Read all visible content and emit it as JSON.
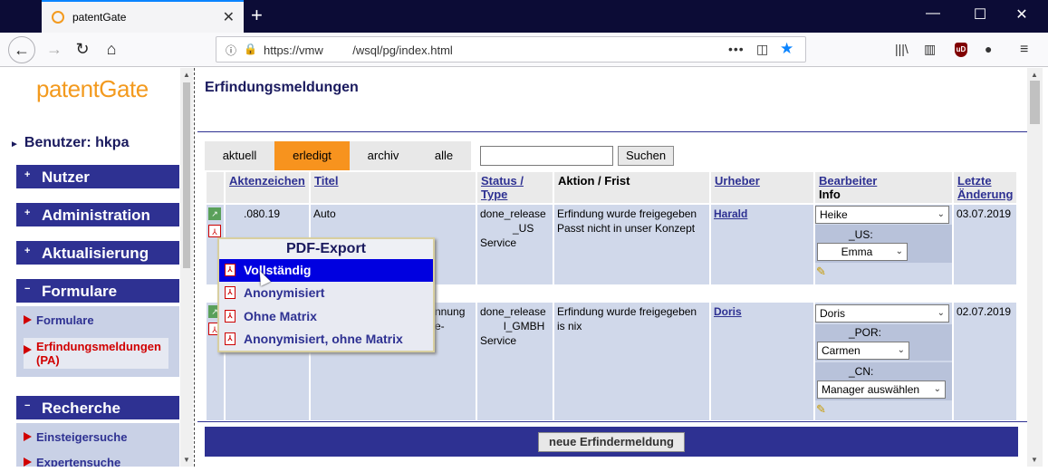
{
  "browser": {
    "tab_title": "patentGate",
    "url": "https://vmw         /wsql/pg/index.html"
  },
  "sidebar": {
    "logo": "patentGate",
    "user": "Benutzer: hkpa",
    "sections": [
      {
        "label": "Nutzer",
        "toggle": "+"
      },
      {
        "label": "Administration",
        "toggle": "+"
      },
      {
        "label": "Aktualisierung",
        "toggle": "+"
      },
      {
        "label": "Formulare",
        "toggle": "−"
      },
      {
        "label": "Recherche",
        "toggle": "−"
      }
    ],
    "formulare_links": [
      "Formulare",
      "Erfindungsmeldungen (PA)"
    ],
    "recherche_links": [
      "Einsteigersuche",
      "Expertensuche"
    ]
  },
  "main": {
    "title": "Erfindungsmeldungen",
    "tabs": [
      "aktuell",
      "erledigt",
      "archiv",
      "alle"
    ],
    "active_tab": "erledigt",
    "search_value": "",
    "search_button": "Suchen",
    "columns": [
      "Aktenzeichen",
      "Titel",
      "Status / Type",
      "Aktion / Frist",
      "Urheber",
      "Bearbeiter",
      "Info",
      "Letzte Änderung"
    ],
    "rows": [
      {
        "aktenzeichen": ".080.19",
        "titel": "Auto",
        "status_1": "done_release",
        "status_2": "_US",
        "status_3": "Service",
        "aktion_1": "Erfindung wurde freigegeben",
        "aktion_2": "Passt nicht in unser Konzept",
        "urheber": "Harald",
        "bearbeiter": "Heike",
        "sub_label": "_US:",
        "sub_value": "Emma",
        "datum": "03.07.2019"
      },
      {
        "titel_1": "nnung",
        "titel_2": "e-",
        "status_1": "done_release",
        "status_2": "l_GMBH",
        "status_3": "Service",
        "aktion_1": "Erfindung wurde freigegeben",
        "aktion_2": "is nix",
        "urheber": "Doris",
        "bearbeiter": "Doris",
        "sub1_label": "_POR:",
        "sub1_value": "Carmen",
        "sub2_label": "_CN:",
        "sub2_value": "Manager auswählen",
        "datum": "02.07.2019"
      }
    ],
    "pdf_menu": {
      "title": "PDF-Export",
      "items": [
        "Vollständig",
        "Anonymisiert",
        "Ohne Matrix",
        "Anonymisiert, ohne Matrix"
      ],
      "highlighted": "Vollständig"
    },
    "new_button": "neue Erfindermeldung"
  },
  "icons": [
    "close-icon",
    "plus-icon",
    "back-icon",
    "forward-icon",
    "reload-icon",
    "home-icon",
    "info-icon",
    "lock-icon",
    "more-icon",
    "pocket-icon",
    "star-icon",
    "library-icon",
    "sidebar-icon",
    "ublock-icon",
    "account-icon",
    "menu-icon",
    "pdf-icon",
    "pencil-icon"
  ],
  "colors": {
    "accent": "#2e3192",
    "active_tab": "#f7931e",
    "highlight": "#0000e0",
    "row_bg": "#d0d8ea",
    "link_active": "#d10000"
  }
}
